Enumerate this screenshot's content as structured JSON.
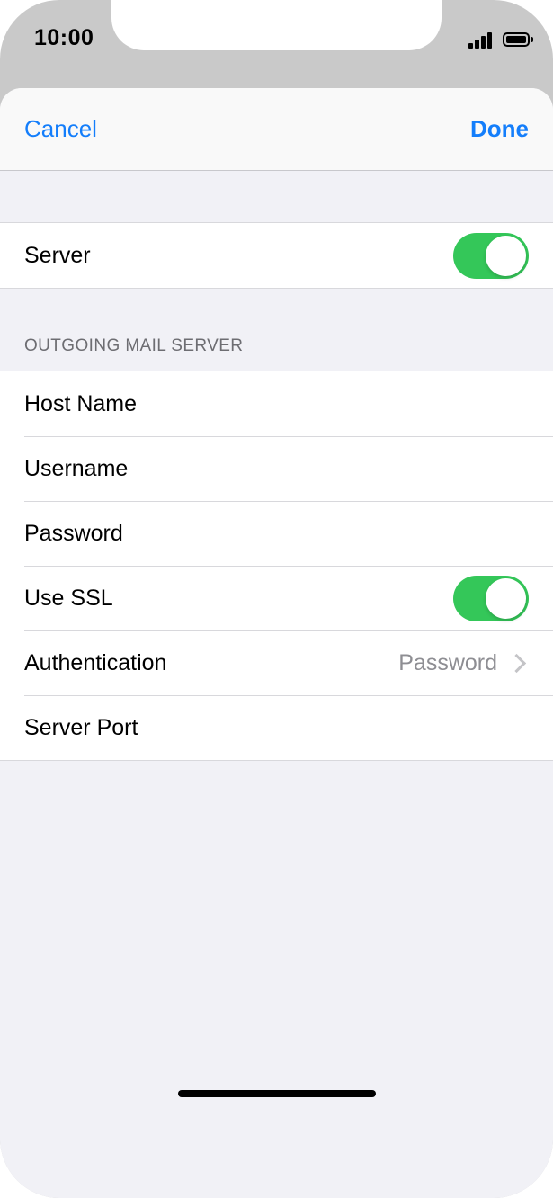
{
  "status_bar": {
    "time": "10:00",
    "signal_icon": "signal-bars-icon",
    "battery_icon": "battery-icon"
  },
  "nav": {
    "cancel_label": "Cancel",
    "done_label": "Done"
  },
  "server_group": {
    "server_label": "Server",
    "server_enabled": true
  },
  "outgoing_section": {
    "header": "OUTGOING MAIL SERVER",
    "rows": [
      {
        "label": "Host Name"
      },
      {
        "label": "Username"
      },
      {
        "label": "Password"
      },
      {
        "label": "Use SSL",
        "toggle_on": true
      },
      {
        "label": "Authentication",
        "value": "Password"
      },
      {
        "label": "Server Port"
      }
    ]
  },
  "colors": {
    "accent": "#147efb",
    "toggle_on": "#34c759",
    "background": "#f1f1f6"
  }
}
